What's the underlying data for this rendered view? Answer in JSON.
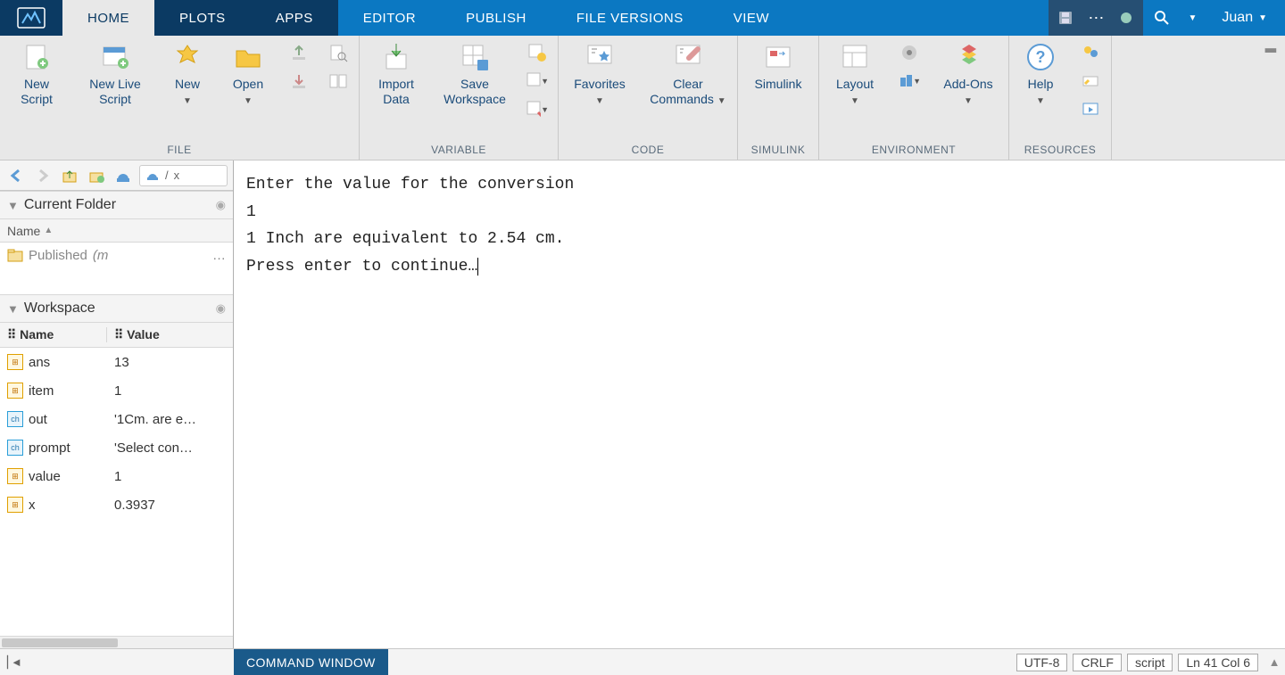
{
  "tabs": {
    "home": "HOME",
    "plots": "PLOTS",
    "apps": "APPS",
    "editor": "EDITOR",
    "publish": "PUBLISH",
    "file_versions": "FILE VERSIONS",
    "view": "VIEW",
    "user": "Juan"
  },
  "ribbon": {
    "file": {
      "label": "FILE",
      "new_script": "New\nScript",
      "new_live_script": "New\nLive Script",
      "new": "New",
      "open": "Open"
    },
    "variable": {
      "label": "VARIABLE",
      "import_data": "Import\nData",
      "save_workspace": "Save\nWorkspace"
    },
    "code": {
      "label": "CODE",
      "favorites": "Favorites",
      "clear_commands": "Clear\nCommands"
    },
    "simulink": {
      "label": "SIMULINK",
      "simulink": "Simulink"
    },
    "environment": {
      "label": "ENVIRONMENT",
      "layout": "Layout",
      "addons": "Add-Ons"
    },
    "resources": {
      "label": "RESOURCES",
      "help": "Help"
    }
  },
  "pathbar": {
    "sep": "/",
    "tail": "x"
  },
  "current_folder": {
    "title": "Current Folder",
    "name_header": "Name",
    "items": [
      {
        "name": "Published",
        "suffix": "(m",
        "more": "…"
      }
    ]
  },
  "workspace": {
    "title": "Workspace",
    "headers": {
      "name": "Name",
      "value": "Value"
    },
    "vars": [
      {
        "name": "ans",
        "value": "13",
        "type": "num"
      },
      {
        "name": "item",
        "value": "1",
        "type": "num"
      },
      {
        "name": "out",
        "value": "'1Cm. are e…",
        "type": "ch"
      },
      {
        "name": "prompt",
        "value": "'Select con…",
        "type": "ch"
      },
      {
        "name": "value",
        "value": "1",
        "type": "num"
      },
      {
        "name": "x",
        "value": "0.3937",
        "type": "num"
      }
    ]
  },
  "console": {
    "lines": [
      "Enter the value for the conversion",
      "1",
      "1 Inch are equivalent to 2.54 cm.",
      "Press enter to continue…"
    ]
  },
  "status": {
    "command_window": "COMMAND WINDOW",
    "encoding": "UTF-8",
    "eol": "CRLF",
    "mode": "script",
    "pos": "Ln  41  Col  6"
  }
}
